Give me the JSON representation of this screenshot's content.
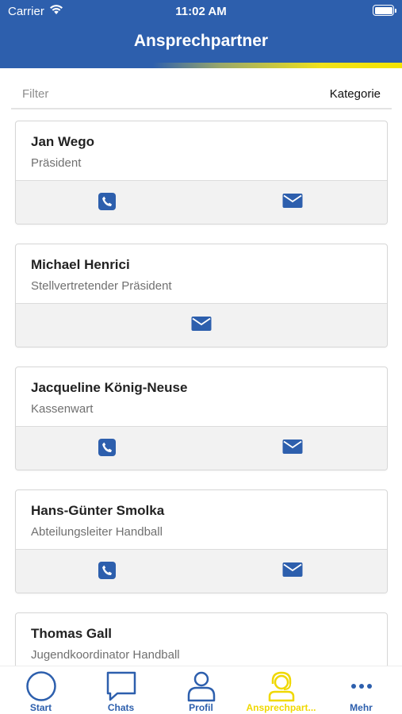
{
  "status_bar": {
    "carrier": "Carrier",
    "time": "11:02 AM"
  },
  "header": {
    "title": "Ansprechpartner"
  },
  "filter": {
    "placeholder": "Filter",
    "category_label": "Kategorie"
  },
  "colors": {
    "brand_blue": "#2d5fad",
    "accent_yellow": "#f0d800",
    "card_footer": "#f2f2f2"
  },
  "contacts": [
    {
      "name": "Jan Wego",
      "role": "Präsident",
      "actions": [
        "phone-icon",
        "mail-icon"
      ]
    },
    {
      "name": "Michael Henrici",
      "role": "Stellvertretender Präsident",
      "actions": [
        "mail-icon"
      ]
    },
    {
      "name": "Jacqueline König-Neuse",
      "role": "Kassenwart",
      "actions": [
        "phone-icon",
        "mail-icon"
      ]
    },
    {
      "name": "Hans-Günter Smolka",
      "role": "Abteilungsleiter Handball",
      "actions": [
        "phone-icon",
        "mail-icon"
      ]
    },
    {
      "name": "Thomas Gall",
      "role": "Jugendkoordinator Handball",
      "actions": []
    }
  ],
  "tabbar": {
    "items": [
      {
        "label": "Start",
        "icon": "circle-icon"
      },
      {
        "label": "Chats",
        "icon": "chat-bubble-icon"
      },
      {
        "label": "Profil",
        "icon": "person-icon"
      },
      {
        "label": "Ansprechpart...",
        "icon": "headset-icon",
        "active": true
      },
      {
        "label": "Mehr",
        "icon": "more-dots-icon"
      }
    ]
  }
}
